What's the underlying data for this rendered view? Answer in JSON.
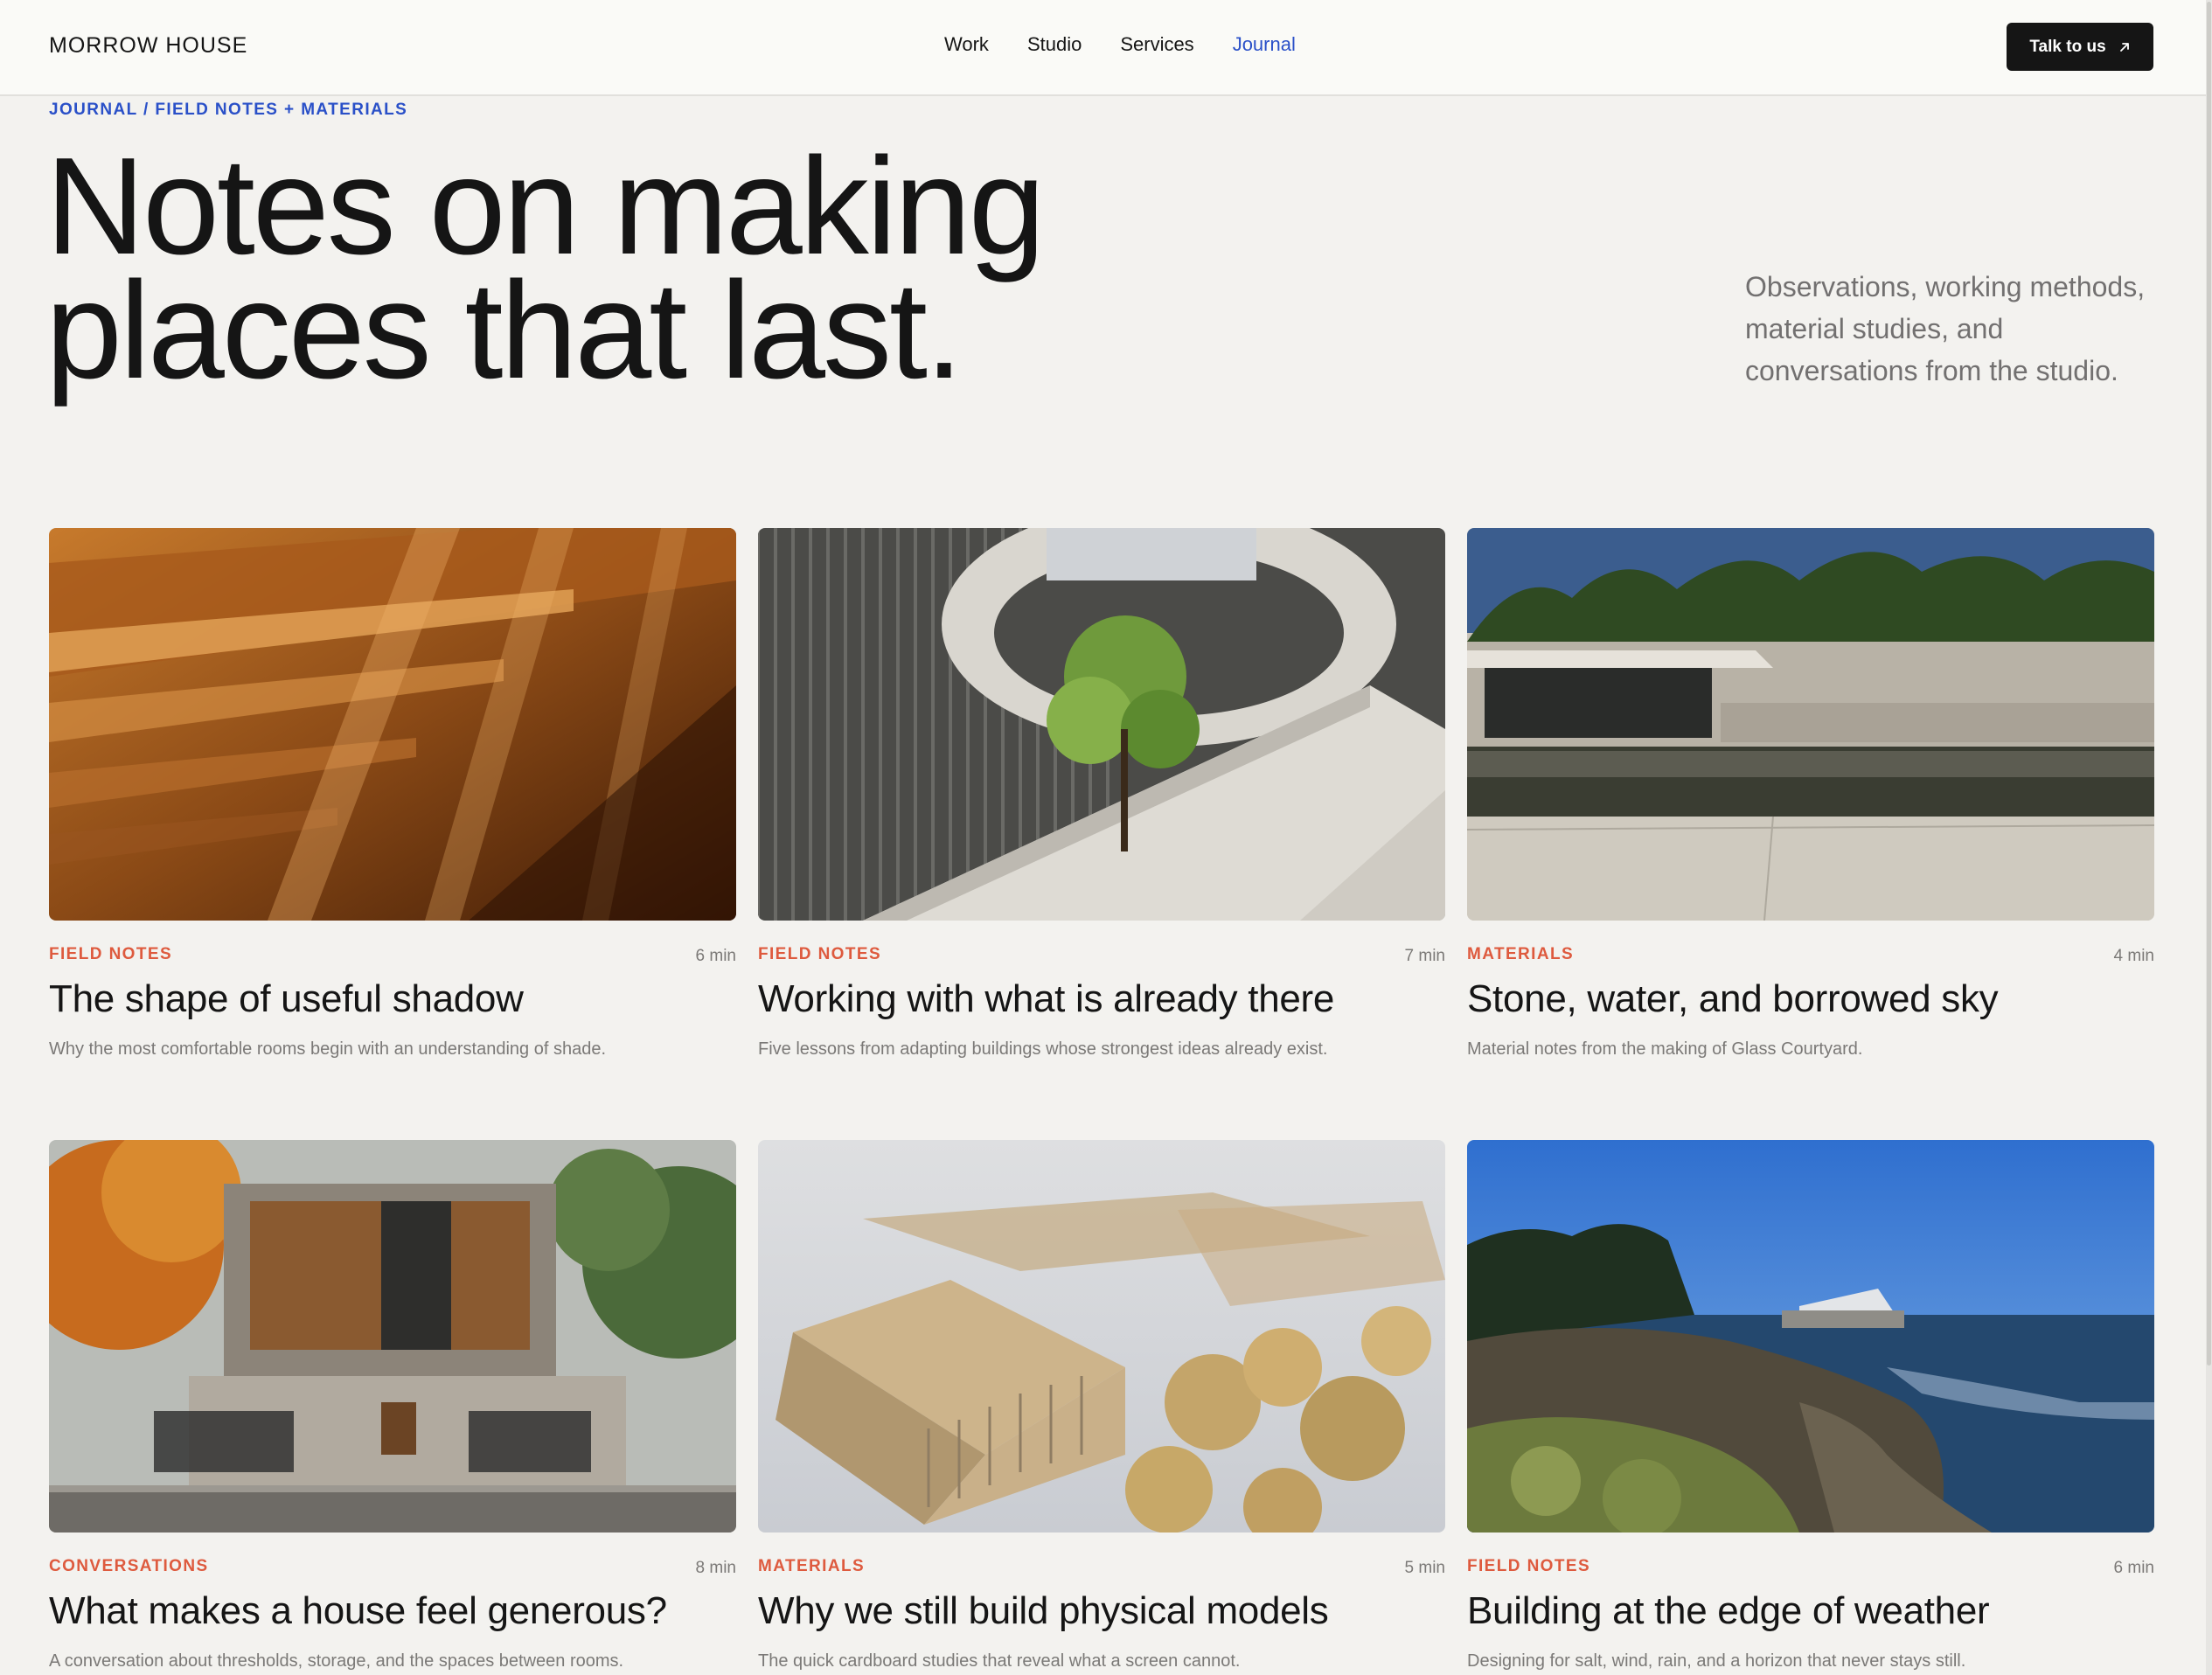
{
  "header": {
    "brand": "MORROW HOUSE",
    "nav": [
      "Work",
      "Studio",
      "Services",
      "Journal"
    ],
    "active_nav": "Journal",
    "cta_label": "Talk to us",
    "cta_icon": "arrow-up-right-icon"
  },
  "hero": {
    "breadcrumb": "JOURNAL / FIELD NOTES + MATERIALS",
    "title_line1": "Notes on making",
    "title_line2": "places that last.",
    "subtitle": "Observations, working methods, material studies, and conversations from the studio."
  },
  "colors": {
    "accent_blue": "#2a50c8",
    "category_orange": "#de5a3e",
    "ink": "#151515",
    "muted": "#7b7977",
    "background": "#f3f2ef"
  },
  "articles": [
    {
      "category": "FIELD NOTES",
      "read_time": "6 min",
      "title": "The shape of useful shadow",
      "excerpt": "Why the most comfortable rooms begin with an understanding of shade.",
      "image": "warm wooden slatted ceiling with shadows"
    },
    {
      "category": "FIELD NOTES",
      "read_time": "7 min",
      "title": "Working with what is already there",
      "excerpt": "Five lessons from adapting buildings whose strongest ideas already exist.",
      "image": "concrete spiral ramp around a tree"
    },
    {
      "category": "MATERIALS",
      "read_time": "4 min",
      "title": "Stone, water, and borrowed sky",
      "excerpt": "Material notes from the making of Glass Courtyard.",
      "image": "stone pavilion beside a reflecting pool"
    },
    {
      "category": "CONVERSATIONS",
      "read_time": "8 min",
      "title": "What makes a house feel generous?",
      "excerpt": "A conversation about thresholds, storage, and the spaces between rooms.",
      "image": "two-storey house with timber screens"
    },
    {
      "category": "MATERIALS",
      "read_time": "5 min",
      "title": "Why we still build physical models",
      "excerpt": "The quick cardboard studies that reveal what a screen cannot.",
      "image": "cardboard architectural model with trees"
    },
    {
      "category": "FIELD NOTES",
      "read_time": "6 min",
      "title": "Building at the edge of weather",
      "excerpt": "Designing for salt, wind, rain, and a horizon that never stays still.",
      "image": "house on a rocky coastline"
    }
  ]
}
